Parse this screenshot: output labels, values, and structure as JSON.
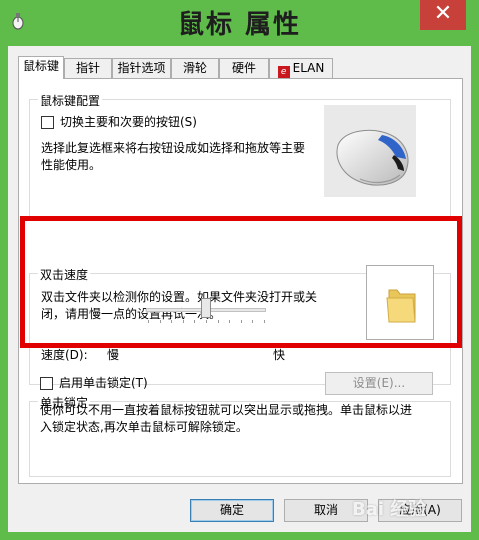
{
  "window": {
    "title": "鼠标 属性",
    "close_glyph": "✕"
  },
  "tabs": [
    {
      "label": "鼠标键",
      "active": true
    },
    {
      "label": "指针"
    },
    {
      "label": "指针选项"
    },
    {
      "label": "滑轮"
    },
    {
      "label": "硬件"
    },
    {
      "label": "ELAN",
      "icon": "elan-logo-icon"
    }
  ],
  "button_config": {
    "group_label": "鼠标键配置",
    "swap_checkbox_label": "切换主要和次要的按钮(S)",
    "swap_checked": false,
    "description_line1": "选择此复选框来将右按钮设成如选择和拖放等主要",
    "description_line2": "性能使用。"
  },
  "double_click": {
    "group_label": "双击速度",
    "description_line1": "双击文件夹以检测你的设置。如果文件夹没打开或关",
    "description_line2": "闭，请用慢一点的设置再试一次。",
    "speed_label": "速度(D):",
    "slow_label": "慢",
    "fast_label": "快",
    "speed_value": 0.5
  },
  "click_lock": {
    "group_label": "单击锁定",
    "checkbox_label": "启用单击锁定(T)",
    "checked": false,
    "settings_button": "设置(E)...",
    "description_line1": "使你可以不用一直按着鼠标按钮就可以突出显示或拖拽。单击鼠标以进",
    "description_line2": "入锁定状态,再次单击鼠标可解除锁定。"
  },
  "footer": {
    "ok": "确定",
    "cancel": "取消",
    "apply": "应用(A)"
  },
  "watermark": "Bai 经验",
  "colors": {
    "accent_frame": "#5fbb4a",
    "close_button": "#c7413a",
    "highlight_box": "#e00000"
  }
}
